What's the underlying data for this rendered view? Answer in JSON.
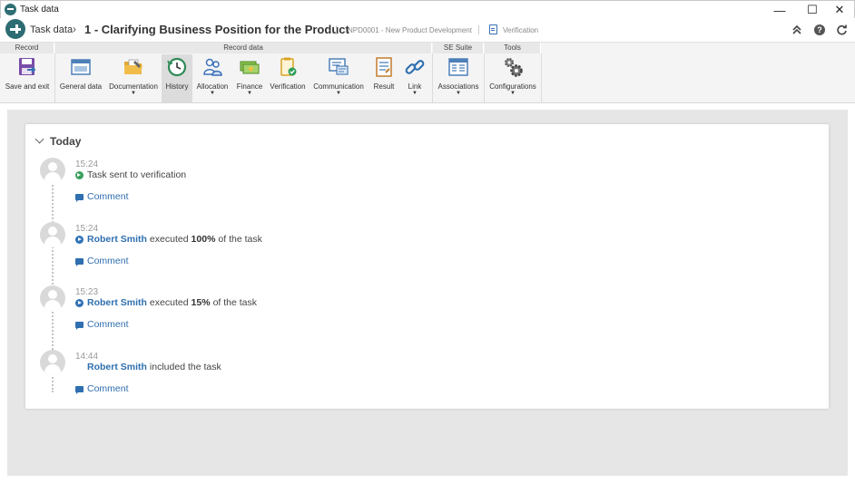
{
  "window": {
    "title": "Task data",
    "controls": {
      "minimize": "—",
      "maximize": "☐",
      "close": "✕"
    }
  },
  "header": {
    "root": "Task data",
    "separator": "›",
    "title": "1 - Clarifying Business Position for the Product",
    "project": "NPD0001 - New Product Development",
    "step": "Verification"
  },
  "ribbon": {
    "groups": [
      {
        "label": "Record"
      },
      {
        "label": "Record data"
      },
      {
        "label": "SE Suite"
      },
      {
        "label": "Tools"
      }
    ],
    "buttons": [
      {
        "label": "Save and exit",
        "icon": "save-exit-icon"
      },
      {
        "label": "General data",
        "icon": "general-data-icon"
      },
      {
        "label": "Documentation",
        "icon": "documentation-icon",
        "dropdown": true
      },
      {
        "label": "History",
        "icon": "history-icon",
        "active": true
      },
      {
        "label": "Allocation",
        "icon": "allocation-icon",
        "dropdown": true
      },
      {
        "label": "Finance",
        "icon": "finance-icon",
        "dropdown": true
      },
      {
        "label": "Verification",
        "icon": "verification-icon"
      },
      {
        "label": "Communication",
        "icon": "communication-icon",
        "dropdown": true
      },
      {
        "label": "Result",
        "icon": "result-icon"
      },
      {
        "label": "Link",
        "icon": "link-icon",
        "dropdown": true
      },
      {
        "label": "Associations",
        "icon": "associations-icon",
        "dropdown": true
      },
      {
        "label": "Configurations",
        "icon": "configurations-icon",
        "dropdown": true
      }
    ],
    "caret": "▼"
  },
  "history": {
    "section_label": "Today",
    "comment_label": "Comment",
    "entries": [
      {
        "time": "15:24",
        "user": "",
        "text": "Task sent to verification",
        "percent": "",
        "suffix": "",
        "icon": "green"
      },
      {
        "time": "15:24",
        "user": "Robert Smith",
        "text": "executed",
        "percent": "100%",
        "suffix": "of the task",
        "icon": "blue"
      },
      {
        "time": "15:23",
        "user": "Robert Smith",
        "text": "executed",
        "percent": "15%",
        "suffix": "of the task",
        "icon": "blue"
      },
      {
        "time": "14:44",
        "user": "Robert Smith",
        "text": "included the task",
        "percent": "",
        "suffix": "",
        "icon": "none"
      }
    ]
  },
  "colors": {
    "accent": "#2f6fb0",
    "brand": "#2d6c73",
    "success": "#3aa05c"
  }
}
